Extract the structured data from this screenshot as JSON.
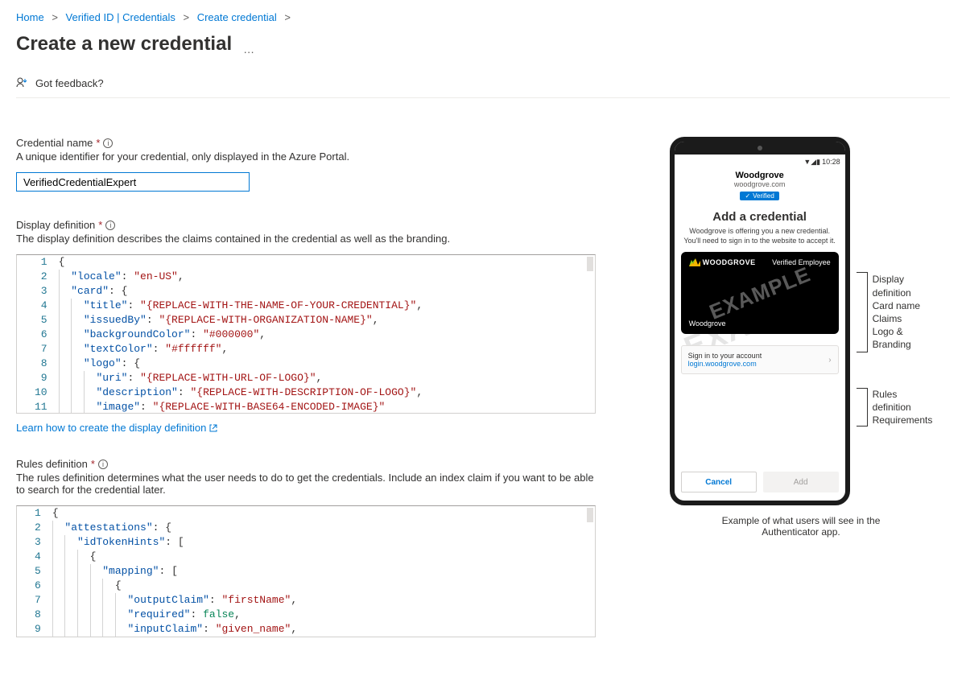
{
  "breadcrumb": {
    "items": [
      {
        "label": "Home"
      },
      {
        "label": "Verified ID | Credentials"
      },
      {
        "label": "Create credential"
      }
    ]
  },
  "page_title": "Create a new credential",
  "toolbar": {
    "feedback": "Got feedback?"
  },
  "credential_name": {
    "label": "Credential name",
    "help": "A unique identifier for your credential, only displayed in the Azure Portal.",
    "value": "VerifiedCredentialExpert"
  },
  "display_def": {
    "label": "Display definition",
    "help": "The display definition describes the claims contained in the credential as well as the branding.",
    "learn_link": "Learn how to create the display definition"
  },
  "rules_def": {
    "label": "Rules definition",
    "help": "The rules definition determines what the user needs to do to get the credentials. Include an index claim if you want to be able to search for the credential later."
  },
  "display_json_lines": [
    "1|{",
    "2|  \"locale\": \"en-US\",",
    "3|  \"card\": {",
    "4|    \"title\": \"{REPLACE-WITH-THE-NAME-OF-YOUR-CREDENTIAL}\",",
    "5|    \"issuedBy\": \"{REPLACE-WITH-ORGANIZATION-NAME}\",",
    "6|    \"backgroundColor\": \"#000000\",",
    "7|    \"textColor\": \"#ffffff\",",
    "8|    \"logo\": {",
    "9|      \"uri\": \"{REPLACE-WITH-URL-OF-LOGO}\",",
    "10|      \"description\": \"{REPLACE-WITH-DESCRIPTION-OF-LOGO}\",",
    "11|      \"image\": \"{REPLACE-WITH-BASE64-ENCODED-IMAGE}\""
  ],
  "rules_json_lines": [
    "1|{",
    "2|  \"attestations\": {",
    "3|    \"idTokenHints\": [",
    "4|      {",
    "5|        \"mapping\": [",
    "6|          {",
    "7|            \"outputClaim\": \"firstName\",",
    "8|            \"required\": false,",
    "9|            \"inputClaim\": \"given_name\","
  ],
  "phone": {
    "time": "10:28",
    "brand": "Woodgrove",
    "domain": "woodgrove.com",
    "verified": "Verified",
    "title": "Add a credential",
    "desc": "Woodgrove is offering you a new credential. You'll need to sign in to the website to accept it.",
    "card_brand": "WOODGROVE",
    "card_type": "Verified Employee",
    "card_issuer": "Woodgrove",
    "watermark": "EXAMPLE",
    "signin_line1": "Sign in to your account",
    "signin_line2": "login.woodgrove.com",
    "btn_cancel": "Cancel",
    "btn_add": "Add"
  },
  "annotations": {
    "display": [
      "Display",
      "definition",
      "Card name",
      "Claims",
      "Logo &",
      "Branding"
    ],
    "rules": [
      "Rules",
      "definition",
      "Requirements"
    ]
  },
  "caption": "Example of what users will see in the Authenticator app."
}
